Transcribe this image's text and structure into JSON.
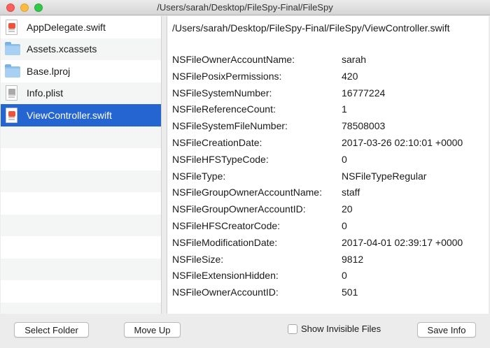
{
  "window": {
    "title": "/Users/sarah/Desktop/FileSpy-Final/FileSpy"
  },
  "sidebar": {
    "items": [
      {
        "label": "AppDelegate.swift",
        "icon": "swift-file-icon"
      },
      {
        "label": "Assets.xcassets",
        "icon": "folder-icon"
      },
      {
        "label": "Base.lproj",
        "icon": "folder-icon"
      },
      {
        "label": "Info.plist",
        "icon": "plist-file-icon"
      },
      {
        "label": "ViewController.swift",
        "icon": "swift-file-icon",
        "selected": true
      }
    ]
  },
  "detail": {
    "path": "/Users/sarah/Desktop/FileSpy-Final/FileSpy/ViewController.swift",
    "attributes": [
      {
        "key": "NSFileOwnerAccountName:",
        "value": "sarah"
      },
      {
        "key": "NSFilePosixPermissions:",
        "value": "420"
      },
      {
        "key": "NSFileSystemNumber:",
        "value": "16777224"
      },
      {
        "key": "NSFileReferenceCount:",
        "value": "1"
      },
      {
        "key": "NSFileSystemFileNumber:",
        "value": "78508003"
      },
      {
        "key": "NSFileCreationDate:",
        "value": "2017-03-26 02:10:01 +0000"
      },
      {
        "key": "NSFileHFSTypeCode:",
        "value": "0"
      },
      {
        "key": "NSFileType:",
        "value": "NSFileTypeRegular"
      },
      {
        "key": "NSFileGroupOwnerAccountName:",
        "value": "staff"
      },
      {
        "key": "NSFileGroupOwnerAccountID:",
        "value": "20"
      },
      {
        "key": "NSFileHFSCreatorCode:",
        "value": "0"
      },
      {
        "key": "NSFileModificationDate:",
        "value": "2017-04-01 02:39:17 +0000"
      },
      {
        "key": "NSFileSize:",
        "value": "9812"
      },
      {
        "key": "NSFileExtensionHidden:",
        "value": "0"
      },
      {
        "key": "NSFileOwnerAccountID:",
        "value": "501"
      }
    ]
  },
  "footer": {
    "select_folder_label": "Select Folder",
    "move_up_label": "Move Up",
    "show_invisible_label": "Show Invisible Files",
    "show_invisible_checked": false,
    "save_info_label": "Save Info"
  },
  "colors": {
    "selection": "#2465d1",
    "close": "#fc605c",
    "minimize": "#fdbc40",
    "maximize": "#34c84a"
  }
}
